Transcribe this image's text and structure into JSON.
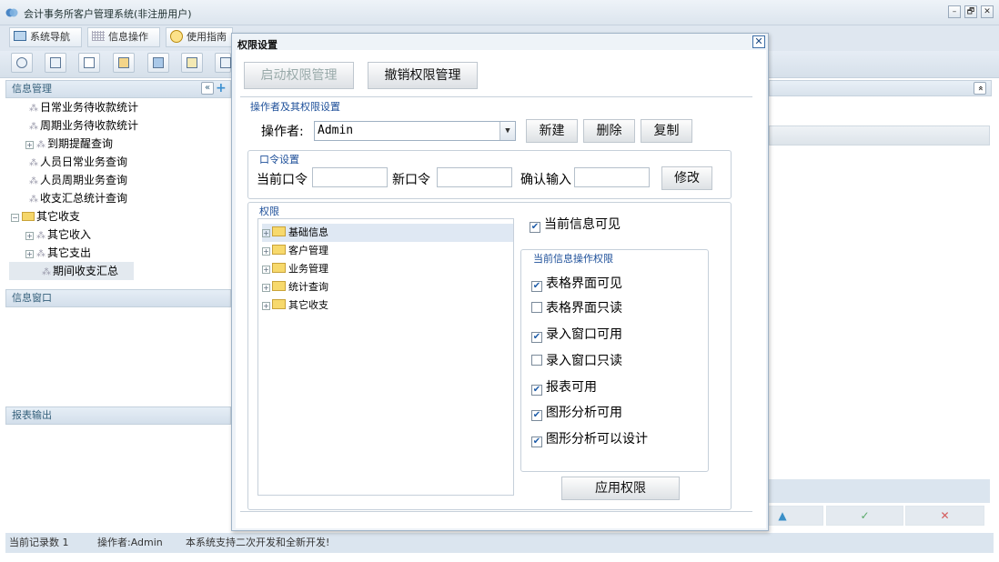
{
  "app": {
    "title": "会计事务所客户管理系统(非注册用户)",
    "window_buttons": [
      "–",
      "🗗",
      "✕"
    ]
  },
  "tabs": [
    "系统导航",
    "信息操作",
    "使用指南"
  ],
  "toolbar_icons": [
    "search-icon",
    "list-icon",
    "document-icon",
    "user-icon",
    "monitor-icon",
    "export-icon",
    "print-icon"
  ],
  "left_panel": {
    "header": "信息管理",
    "collapse_glyph": "«",
    "add_glyph": "+",
    "tree_items": [
      {
        "label": "日常业务待收款统计",
        "type": "leaf",
        "indent": 2
      },
      {
        "label": "周期业务待收款统计",
        "type": "leaf",
        "indent": 2
      },
      {
        "label": "到期提醒查询",
        "type": "expandable-leaf",
        "indent": 1
      },
      {
        "label": "人员日常业务查询",
        "type": "leaf",
        "indent": 2
      },
      {
        "label": "人员周期业务查询",
        "type": "leaf",
        "indent": 2
      },
      {
        "label": "收支汇总统计查询",
        "type": "leaf",
        "indent": 2
      },
      {
        "label": "其它收支",
        "type": "folder",
        "indent": 0
      },
      {
        "label": "其它收入",
        "type": "expandable-leaf",
        "indent": 1
      },
      {
        "label": "其它支出",
        "type": "expandable-leaf",
        "indent": 1
      },
      {
        "label": "期间收支汇总",
        "type": "leaf",
        "indent": 2,
        "selected": true
      }
    ],
    "info_window_header": "信息窗口",
    "report_header": "报表输出"
  },
  "right_panel": {
    "collapse_glyph": "«",
    "bottom_buttons": [
      "▲",
      "✓",
      "✕"
    ],
    "colors": {
      "up": "#3a8fc7",
      "check": "#5aaa6a",
      "cross": "#d45a5a"
    }
  },
  "status_bar": {
    "record_count": "当前记录数 1",
    "operator": "操作者:Admin",
    "note": "本系统支持二次开发和全新开发!"
  },
  "dialog": {
    "title": "权限设置",
    "close_glyph": "✕",
    "enable_btn": "启动权限管理",
    "revoke_btn": "撤销权限管理",
    "operator_section": "操作者及其权限设置",
    "operator_label": "操作者:",
    "operator_value": "Admin",
    "new_btn": "新建",
    "delete_btn": "删除",
    "copy_btn": "复制",
    "password_section": "口令设置",
    "current_pw_label": "当前口令",
    "new_pw_label": "新口令",
    "confirm_label": "确认输入",
    "modify_btn": "修改",
    "perm_section": "权限",
    "perm_tree": [
      "基础信息",
      "客户管理",
      "业务管理",
      "统计查询",
      "其它收支"
    ],
    "visible_label": "当前信息可见",
    "visible_checked": true,
    "ops_section": "当前信息操作权限",
    "ops": [
      {
        "label": "表格界面可见",
        "checked": true
      },
      {
        "label": "表格界面只读",
        "checked": false
      },
      {
        "label": "录入窗口可用",
        "checked": true
      },
      {
        "label": "录入窗口只读",
        "checked": false
      },
      {
        "label": "报表可用",
        "checked": true
      },
      {
        "label": "图形分析可用",
        "checked": true
      },
      {
        "label": "图形分析可以设计",
        "checked": true
      }
    ],
    "apply_btn": "应用权限"
  }
}
